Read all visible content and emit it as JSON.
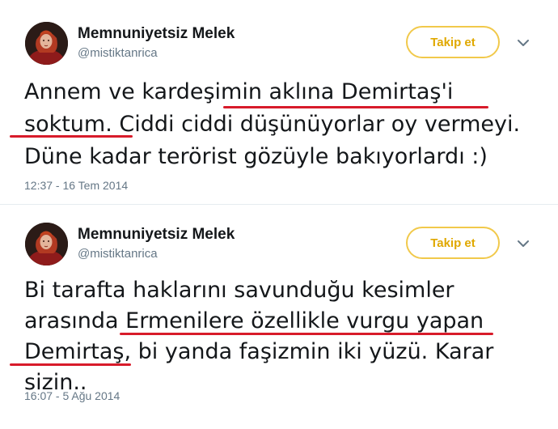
{
  "tweets": [
    {
      "display_name": "Memnuniyetsiz Melek",
      "handle": "@mistiktanrica",
      "follow_label": "Takip et",
      "text_lines": [
        "Annem ve kardeşimin aklına Demirtaş'i",
        "soktum. Ciddi ciddi düşünüyorlar oy vermeyi.",
        "Düne kadar terörist gözüyle bakıyorlardı :)"
      ],
      "timestamp": "12:37 - 16 Tem 2014"
    },
    {
      "display_name": "Memnuniyetsiz Melek",
      "handle": "@mistiktanrica",
      "follow_label": "Takip et",
      "text_lines": [
        "Bi tarafta haklarını savunduğu kesimler",
        "arasında Ermenilere özellikle vurgu yapan",
        "Demirtaş, bi yanda faşizmin iki yüzü. Karar",
        "sizin.."
      ],
      "timestamp": "16:07 - 5 Ağu 2014"
    }
  ],
  "colors": {
    "accent": "#e0a800",
    "follow_border": "#f1c94b",
    "annotation": "#d81b2a",
    "secondary_text": "#657786"
  },
  "icons": {
    "avatar": "avatar-image",
    "menu": "chevron-down-icon"
  }
}
